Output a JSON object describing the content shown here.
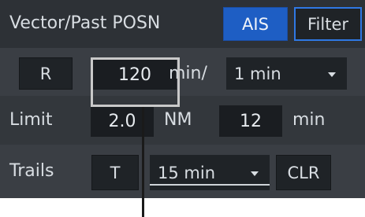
{
  "row1": {
    "label": "Vector/Past POSN",
    "ais_button": "AIS",
    "filter_button": "Filter"
  },
  "row2": {
    "r_button": "R",
    "vector_time_value": "120",
    "unit_label": "min/",
    "interval_select": "1 min"
  },
  "row3": {
    "label": "Limit",
    "distance_value": "2.0",
    "distance_unit": "NM",
    "time_value": "12",
    "time_unit": "min"
  },
  "row4": {
    "label": "Trails",
    "t_button": "T",
    "trails_select": "15 min",
    "clr_button": "CLR"
  },
  "colors": {
    "accent_blue": "#1e5ec4",
    "outline_blue": "#2f78e4",
    "panel_bg": "#2b2f34"
  },
  "icons": {
    "dropdown": "caret-down-icon"
  }
}
